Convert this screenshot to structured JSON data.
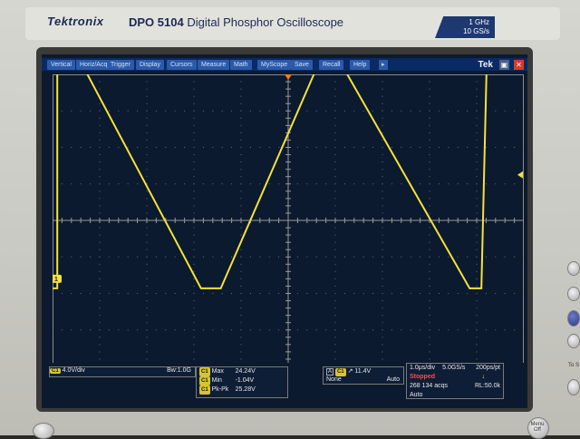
{
  "device": {
    "brand": "Tektronix",
    "model": "DPO 5104",
    "model_desc": "Digital Phosphor Oscilloscope",
    "spec_bandwidth": "1 GHz",
    "spec_rate": "10 GS/s",
    "menu_button_label": "Menu\nOff",
    "side_label": "To S"
  },
  "menu": [
    {
      "label": "Vertical"
    },
    {
      "label": "Horiz/Acq"
    },
    {
      "label": "Trigger"
    },
    {
      "label": "Display"
    },
    {
      "label": "Cursors"
    },
    {
      "label": "Measure"
    },
    {
      "label": "Math"
    },
    {
      "label": "MyScope"
    },
    {
      "label": "Save"
    },
    {
      "label": "Recall"
    },
    {
      "label": "Help"
    }
  ],
  "screen": {
    "logo": "Tek",
    "trace_color": "#f4e23a",
    "accent": "#2c5aa8"
  },
  "channel": {
    "marker": "1",
    "scale": "4.0V/div",
    "bandwidth": "Bw:1.0G"
  },
  "measurements": [
    {
      "chip": "C1",
      "label": "Max",
      "value": "24.24V"
    },
    {
      "chip": "C1",
      "label": "Min",
      "value": "-1.04V"
    },
    {
      "chip": "C1",
      "label": "Pk-Pk",
      "value": "25.28V"
    }
  ],
  "trigger": {
    "mode_letter": "A",
    "chip": "C1",
    "level": "11.4V",
    "coupling": "None",
    "mode": "Auto"
  },
  "acquisition": {
    "timebase": "1.0μs/div",
    "sample_rate": "5.0GS/s",
    "resolution": "200ps/pt",
    "status": "Stopped",
    "acqs": "268 134 acqs",
    "record_length": "RL:50.0k",
    "mode": "Auto"
  },
  "waveform": {
    "shape": "square",
    "high_level_v": 24.24,
    "low_level_v": -1.04,
    "volts_per_div": 4.0,
    "time_per_div_us": 1.0,
    "edges_div": [
      0.1,
      0.55,
      3.15,
      3.57,
      5.7,
      6.05,
      8.85,
      9.1
    ],
    "levels": [
      "high",
      "low",
      "high",
      "low",
      "high"
    ]
  }
}
